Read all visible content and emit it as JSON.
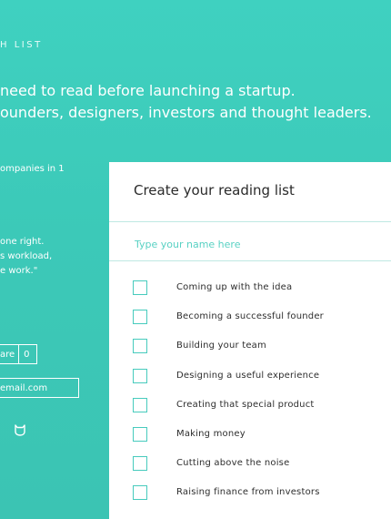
{
  "header": {
    "brand": "H LIST",
    "hero_line_1": "need to read before launching a startup.",
    "hero_line_2": "ounders, designers, investors and thought leaders."
  },
  "sidebar": {
    "companies_text": "ompanies in 1",
    "quote_lines": [
      "one right.",
      "s workload,",
      "e work.\""
    ],
    "share_label": "are",
    "share_count": "0",
    "email_value": "email.com"
  },
  "card": {
    "title": "Create your reading list",
    "name_placeholder": "Type your name here",
    "items": [
      {
        "label": "Coming up with the idea",
        "checked": false
      },
      {
        "label": "Becoming a successful founder",
        "checked": false
      },
      {
        "label": "Building your team",
        "checked": false
      },
      {
        "label": "Designing a useful experience",
        "checked": false
      },
      {
        "label": "Creating that special product",
        "checked": false
      },
      {
        "label": "Making money",
        "checked": false
      },
      {
        "label": "Cutting above the noise",
        "checked": false
      },
      {
        "label": "Raising finance from investors",
        "checked": false
      }
    ]
  },
  "colors": {
    "background": "#3fd1c0",
    "accent": "#47cbbd",
    "card": "#ffffff"
  },
  "icons": {
    "bottom": "cat-face-icon"
  }
}
